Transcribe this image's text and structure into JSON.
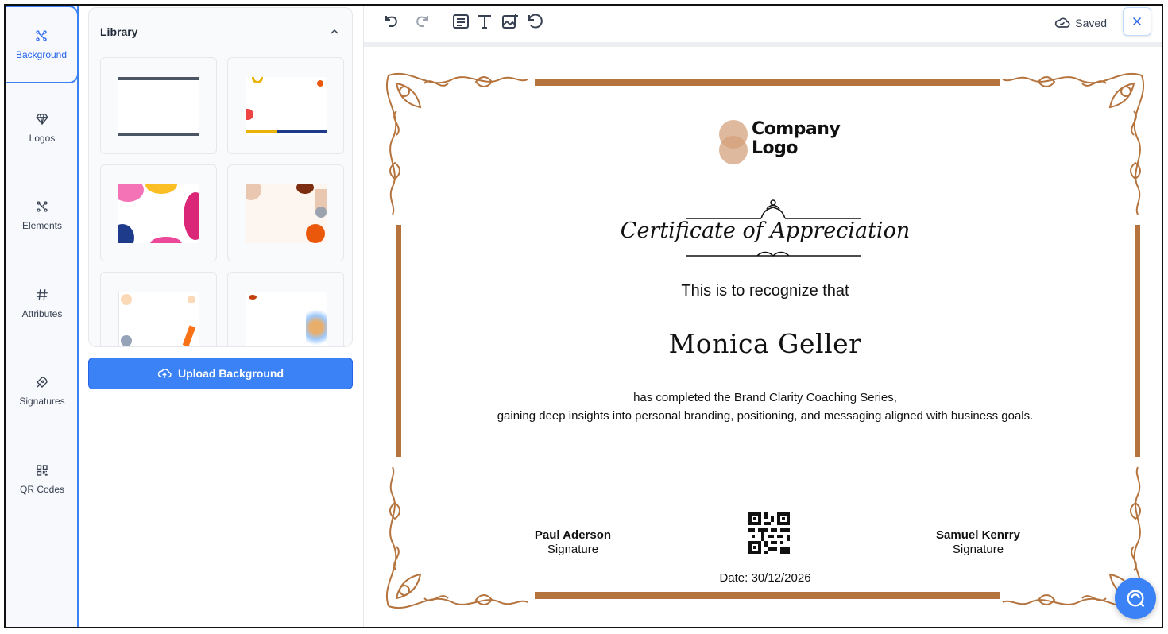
{
  "sidebar": {
    "items": [
      {
        "label": "Background",
        "icon": "background-icon",
        "active": true
      },
      {
        "label": "Logos",
        "icon": "diamond-icon"
      },
      {
        "label": "Elements",
        "icon": "elements-icon"
      },
      {
        "label": "Attributes",
        "icon": "hash-icon"
      },
      {
        "label": "Signatures",
        "icon": "pen-nib-icon"
      },
      {
        "label": "QR Codes",
        "icon": "qr-code-icon"
      }
    ]
  },
  "library": {
    "title": "Library",
    "upload_label": "Upload Background"
  },
  "toolbar": {
    "saved_label": "Saved"
  },
  "certificate": {
    "logo_text_line1": "Company",
    "logo_text_line2": "Logo",
    "title": "Certificate of Appreciation",
    "recognize": "This is to recognize that",
    "recipient": "Monica Geller",
    "desc_line1": "has completed the Brand Clarity Coaching Series,",
    "desc_line2": "gaining deep insights into personal branding, positioning, and messaging aligned with business goals.",
    "sig_left_name": "Paul Aderson",
    "sig_left_role": "Signature",
    "sig_right_name": "Samuel Kenrry",
    "sig_right_role": "Signature",
    "date": "Date: 30/12/2026"
  },
  "colors": {
    "accent": "#3b82f6",
    "border_gold": "#b5733d",
    "logo_tan": "#d4a27c"
  }
}
